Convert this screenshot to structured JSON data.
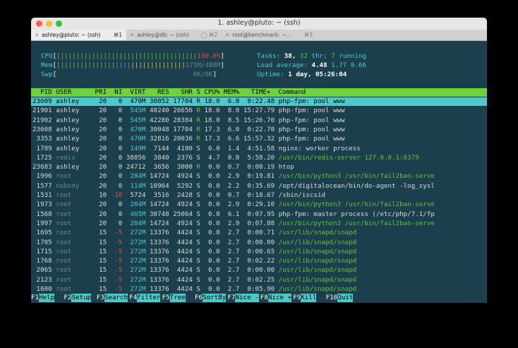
{
  "window": {
    "title": "1. ashley@pluto: ~ (ssh)"
  },
  "tabs": [
    {
      "label": "ashley@pluto: ~ (ssh)",
      "shortcut": "⌘1",
      "active": true
    },
    {
      "label": "ashley@db: ~ (ssh)",
      "shortcut": "⌘2",
      "active": false
    },
    {
      "label": "root@benchmark: ~...",
      "shortcut": "⌘3",
      "active": false
    }
  ],
  "meters": {
    "cpu_label": "CPU",
    "cpu_bars_green": "||||||||||||||||||||||||||||||||||||",
    "cpu_value": "100.0%",
    "mem_label": "Mem",
    "mem_bars_green": "|||||||||||||||",
    "mem_bars_blue": "||||",
    "mem_bars_yellow": "||||||||||||||",
    "mem_value": "171M/488M",
    "swp_label": "Swp",
    "swp_value": "0K/0K"
  },
  "stats": {
    "tasks_label": "Tasks:",
    "tasks": "38,",
    "threads": "32",
    "thr_label": "thr;",
    "running": "7",
    "running_label": "running",
    "load_label": "Load average:",
    "load1": "4.48",
    "load5": "1.77",
    "load15": "0.66",
    "uptime_label": "Uptime:",
    "uptime": "1 day, 05:26:04"
  },
  "table": {
    "header": "  PID USER      PRI  NI  VIRT   RES   SHR S CPU% MEM%   TIME+  Command",
    "rows": [
      {
        "pid": "23609",
        "user": "ashley",
        "pri": "20",
        "ni": "0",
        "virt": "470M",
        "res": "30052",
        "shr": "17704",
        "s": "R",
        "cpu": "18.0",
        "mem": "6.0",
        "time": "0:22.48",
        "cmd": "php-fpm: pool www",
        "sel": true
      },
      {
        "pid": "21901",
        "user": "ashley",
        "pri": "20",
        "ni": "0",
        "virt": "545M",
        "res": "40240",
        "shr": "26656",
        "s": "R",
        "cpu": "18.0",
        "mem": "8.0",
        "time": "15:27.79",
        "cmd": "php-fpm: pool www"
      },
      {
        "pid": "21902",
        "user": "ashley",
        "pri": "20",
        "ni": "0",
        "virt": "545M",
        "res": "42280",
        "shr": "28384",
        "s": "R",
        "cpu": "18.0",
        "mem": "8.5",
        "time": "15:26.70",
        "cmd": "php-fpm: pool www"
      },
      {
        "pid": "23608",
        "user": "ashley",
        "pri": "20",
        "ni": "0",
        "virt": "470M",
        "res": "30048",
        "shr": "17704",
        "s": "R",
        "cpu": "17.3",
        "mem": "6.0",
        "time": "0:22.70",
        "cmd": "php-fpm: pool www"
      },
      {
        "pid": "3353",
        "user": "ashley",
        "pri": "20",
        "ni": "0",
        "virt": "470M",
        "res": "32816",
        "shr": "20036",
        "s": "R",
        "cpu": "17.3",
        "mem": "6.6",
        "time": "15:57.32",
        "cmd": "php-fpm: pool www"
      },
      {
        "pid": "1789",
        "user": "ashley",
        "pri": "20",
        "ni": "0",
        "virt": "149M",
        "res": "7144",
        "shr": "4180",
        "s": "S",
        "cpu": "6.0",
        "mem": "1.4",
        "time": "4:51.58",
        "cmd": "nginx: worker process"
      },
      {
        "pid": "1725",
        "user": "redis",
        "pri": "20",
        "ni": "0",
        "virt": "38856",
        "res": "3840",
        "shr": "2376",
        "s": "S",
        "cpu": "4.7",
        "mem": "0.8",
        "time": "5:58.20",
        "cmd": "/usr/bin/redis-server 127.0.0.1:6379"
      },
      {
        "pid": "23683",
        "user": "ashley",
        "pri": "20",
        "ni": "0",
        "virt": "24712",
        "res": "3656",
        "shr": "3000",
        "s": "R",
        "cpu": "0.0",
        "mem": "0.7",
        "time": "0:00.19",
        "cmd": "htop"
      },
      {
        "pid": "1996",
        "user": "root",
        "pri": "20",
        "ni": "0",
        "virt": "284M",
        "res": "14724",
        "shr": "4924",
        "s": "S",
        "cpu": "0.0",
        "mem": "2.9",
        "time": "0:19.81",
        "cmd": "/usr/bin/python3 /usr/bin/fail2ban-serve"
      },
      {
        "pid": "1577",
        "user": "nobody",
        "pri": "20",
        "ni": "0",
        "virt": "114M",
        "res": "10964",
        "shr": "5292",
        "s": "S",
        "cpu": "0.0",
        "mem": "2.2",
        "time": "0:35.69",
        "cmd": "/opt/digitalocean/bin/do-agent -log_sysl"
      },
      {
        "pid": "1531",
        "user": "root",
        "pri": "10",
        "ni": "-10",
        "virt": "5724",
        "res": "3516",
        "shr": "2428",
        "s": "S",
        "cpu": "0.0",
        "mem": "0.7",
        "time": "0:18.67",
        "cmd": "/sbin/iscsid"
      },
      {
        "pid": "1973",
        "user": "root",
        "pri": "20",
        "ni": "0",
        "virt": "284M",
        "res": "14724",
        "shr": "4924",
        "s": "S",
        "cpu": "0.0",
        "mem": "2.9",
        "time": "0:29.10",
        "cmd": "/usr/bin/python3 /usr/bin/fail2ban-serve"
      },
      {
        "pid": "1568",
        "user": "root",
        "pri": "20",
        "ni": "0",
        "virt": "465M",
        "res": "30748",
        "shr": "25064",
        "s": "S",
        "cpu": "0.0",
        "mem": "6.1",
        "time": "0:07.95",
        "cmd": "php-fpm: master process (/etc/php/7.1/fp"
      },
      {
        "pid": "1997",
        "user": "root",
        "pri": "20",
        "ni": "0",
        "virt": "284M",
        "res": "14724",
        "shr": "4924",
        "s": "S",
        "cpu": "0.0",
        "mem": "2.9",
        "time": "0:07.88",
        "cmd": "/usr/bin/python3 /usr/bin/fail2ban-serve"
      },
      {
        "pid": "1695",
        "user": "root",
        "pri": "15",
        "ni": "-5",
        "virt": "272M",
        "res": "13376",
        "shr": "4424",
        "s": "S",
        "cpu": "0.0",
        "mem": "2.7",
        "time": "0:00.71",
        "cmd": "/usr/lib/snapd/snapd"
      },
      {
        "pid": "1705",
        "user": "root",
        "pri": "15",
        "ni": "-5",
        "virt": "272M",
        "res": "13376",
        "shr": "4424",
        "s": "S",
        "cpu": "0.0",
        "mem": "2.7",
        "time": "0:00.00",
        "cmd": "/usr/lib/snapd/snapd"
      },
      {
        "pid": "1715",
        "user": "root",
        "pri": "15",
        "ni": "-5",
        "virt": "272M",
        "res": "13376",
        "shr": "4424",
        "s": "S",
        "cpu": "0.0",
        "mem": "2.7",
        "time": "0:00.65",
        "cmd": "/usr/lib/snapd/snapd"
      },
      {
        "pid": "1768",
        "user": "root",
        "pri": "15",
        "ni": "-5",
        "virt": "272M",
        "res": "13376",
        "shr": "4424",
        "s": "S",
        "cpu": "0.0",
        "mem": "2.7",
        "time": "0:02.22",
        "cmd": "/usr/lib/snapd/snapd"
      },
      {
        "pid": "2065",
        "user": "root",
        "pri": "15",
        "ni": "-5",
        "virt": "272M",
        "res": "13376",
        "shr": "4424",
        "s": "S",
        "cpu": "0.0",
        "mem": "2.7",
        "time": "0:00.00",
        "cmd": "/usr/lib/snapd/snapd"
      },
      {
        "pid": "2123",
        "user": "root",
        "pri": "15",
        "ni": "-5",
        "virt": "272M",
        "res": "13376",
        "shr": "4424",
        "s": "S",
        "cpu": "0.0",
        "mem": "2.7",
        "time": "0:02.25",
        "cmd": "/usr/lib/snapd/snapd"
      },
      {
        "pid": "1600",
        "user": "root",
        "pri": "15",
        "ni": "-5",
        "virt": "272M",
        "res": "13376",
        "shr": "4424",
        "s": "S",
        "cpu": "0.0",
        "mem": "2.7",
        "time": "0:05.90",
        "cmd": "/usr/lib/snapd/snapd"
      }
    ]
  },
  "fkeys": [
    {
      "key": "F1",
      "label": "Help  "
    },
    {
      "key": "F2",
      "label": "Setup "
    },
    {
      "key": "F3",
      "label": "Search"
    },
    {
      "key": "F4",
      "label": "Filter"
    },
    {
      "key": "F5",
      "label": "Tree  "
    },
    {
      "key": "F6",
      "label": "SortBy"
    },
    {
      "key": "F7",
      "label": "Nice -"
    },
    {
      "key": "F8",
      "label": "Nice +"
    },
    {
      "key": "F9",
      "label": "Kill  "
    },
    {
      "key": "F10",
      "label": "Quit  "
    }
  ],
  "colors": {
    "terminal_bg": "#1c3f4e",
    "header_bar": "#6fd140",
    "selected_row": "#4ec9c9",
    "green": "#6abf3a",
    "red": "#e04a4a",
    "blue": "#4a8ee0",
    "yellow": "#e0c33a"
  }
}
